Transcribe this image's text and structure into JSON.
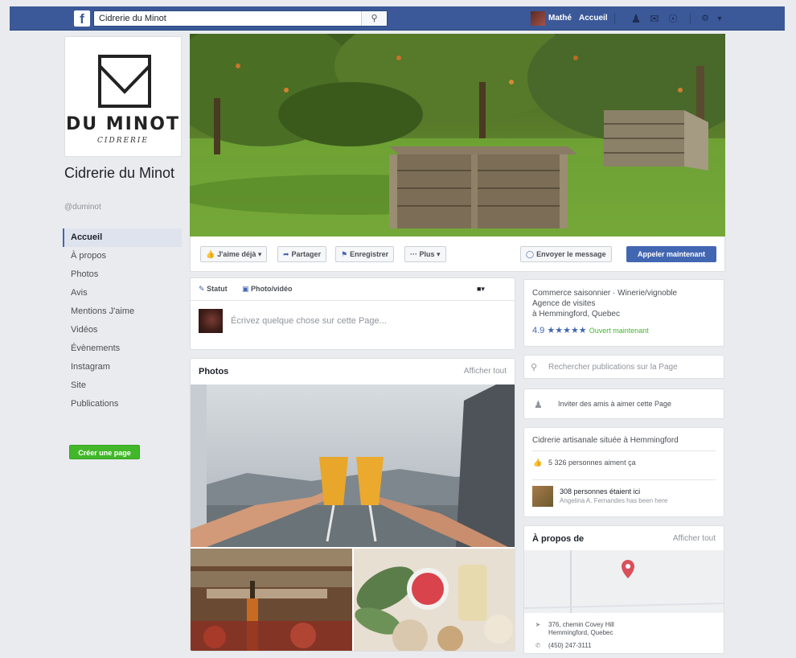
{
  "topbar": {
    "logo": "f",
    "search_value": "Cidrerie du Minot",
    "user_name": "Mathé",
    "home_label": "Accueil"
  },
  "page": {
    "logo_title": "DU MINOT",
    "logo_sub": "CIDRERIE",
    "name": "Cidrerie du Minot",
    "handle": "@duminot"
  },
  "nav": {
    "items": [
      "Accueil",
      "À propos",
      "Photos",
      "Avis",
      "Mentions J'aime",
      "Vidéos",
      "Évènements",
      "Instagram",
      "Site",
      "Publications"
    ],
    "create_page": "Créer une page"
  },
  "actions": {
    "like": "J'aime déjà ▾",
    "share": "Partager",
    "save": "Enregistrer",
    "more": "··· Plus ▾",
    "message": "Envoyer le message",
    "call": "Appeler maintenant"
  },
  "composer": {
    "tab_status": "Statut",
    "tab_photo": "Photo/vidéo",
    "placeholder": "Écrivez quelque chose sur cette Page..."
  },
  "photos": {
    "title": "Photos",
    "see_all": "Afficher tout"
  },
  "info": {
    "category": "Commerce saisonnier · Winerie/vignoble",
    "category2": "Agence de visites",
    "location": "à Hemmingford, Quebec",
    "rating": "4.9",
    "stars": "★★★★★",
    "open_status": "Ouvert maintenant"
  },
  "search_posts": "Rechercher publications sur la Page",
  "invite": "Inviter des amis à aimer cette Page",
  "community": {
    "description": "Cidrerie artisanale située à Hemmingford",
    "likes": "5 326 personnes aiment ça",
    "visits": "308 personnes étaient ici",
    "visits_sub": "Angelina A. Fernandes has been here"
  },
  "about": {
    "title": "À propos de",
    "see_all": "Afficher tout",
    "address_line1": "376, chemin Covey Hill",
    "address_line2": "Hemmingford, Quebec",
    "phone": "(450) 247-3111"
  },
  "colors": {
    "brand": "#3b5998",
    "primary_button": "#4267b2",
    "create_button": "#42b72a",
    "background": "#e9ebee"
  }
}
